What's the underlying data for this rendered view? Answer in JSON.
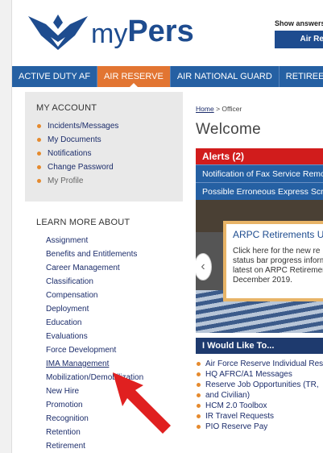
{
  "header": {
    "brand_my": "my",
    "brand_pers": "Pers",
    "show_answers": "Show answers",
    "air_res_btn": "Air Res"
  },
  "nav": {
    "items": [
      "ACTIVE DUTY AF",
      "AIR RESERVE",
      "AIR NATIONAL GUARD",
      "RETIREE"
    ],
    "active": "AIR RESERVE"
  },
  "account": {
    "title": "MY ACCOUNT",
    "items": [
      "Incidents/Messages",
      "My Documents",
      "Notifications",
      "Change Password",
      "My Profile"
    ]
  },
  "learn": {
    "title": "LEARN MORE ABOUT",
    "items": [
      "Assignment",
      "Benefits and Entitlements",
      "Career Management",
      "Classification",
      "Compensation",
      "Deployment",
      "Education",
      "Evaluations",
      "Force Development",
      "IMA Management",
      "Mobilization/Demobilization",
      "New Hire",
      "Promotion",
      "Recognition",
      "Retention",
      "Retirement"
    ]
  },
  "breadcrumb": {
    "home": "Home",
    "sep": ">",
    "current": "Officer"
  },
  "main": {
    "welcome": "Welcome"
  },
  "alerts": {
    "title": "Alerts (2)",
    "items": [
      "Notification of Fax Service Remo",
      "Possible Erroneous Express Scrip"
    ]
  },
  "carousel": {
    "heading": "ARPC Retirements Up",
    "body": "Click here for the new re status bar progress inform latest on ARPC Retiremen December 2019.",
    "prev": "‹"
  },
  "would": {
    "title": "I Would Like To...",
    "items": [
      "Air Force Reserve Individual Res",
      "HQ AFRC/A1 Messages",
      "Reserve Job Opportunities (TR,",
      "and Civilian)",
      "HCM 2.0 Toolbox",
      "IR Travel Requests",
      "PIO Reserve Pay"
    ]
  },
  "colors": {
    "nav_blue": "#2560a3",
    "nav_active": "#e27532",
    "alert_red": "#d11c1c",
    "arrow_red": "#e02020"
  }
}
